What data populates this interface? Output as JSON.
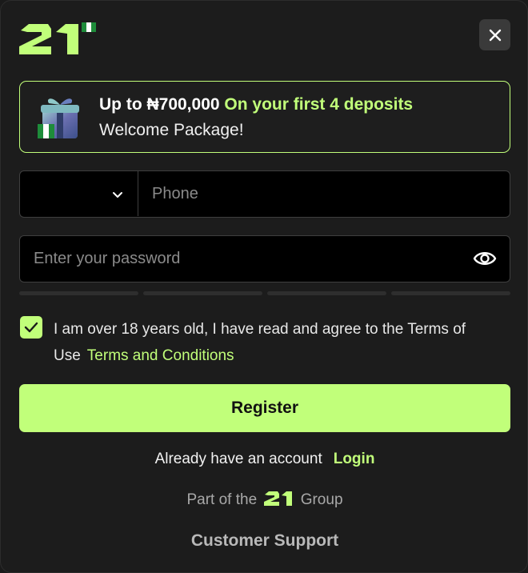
{
  "brand": {
    "logo_text": "21",
    "accent_color": "#c1ff7a",
    "flag": "nigeria-flag"
  },
  "promo": {
    "amount_text": "Up to ₦700,000",
    "highlight_text": "On your first 4 deposits",
    "subtitle": "Welcome Package!",
    "icon": "gift-icon"
  },
  "form": {
    "country_select": {
      "value": "",
      "icon": "chevron-down-icon"
    },
    "phone": {
      "placeholder": "Phone",
      "value": ""
    },
    "password": {
      "placeholder": "Enter your password",
      "value": "",
      "icon": "eye-icon"
    },
    "password_strength_segments": 4,
    "password_strength_level": 0
  },
  "terms": {
    "checked": true,
    "text": "I am over 18 years old, I have read and agree to the Terms of Use",
    "link_text": "Terms and Conditions"
  },
  "actions": {
    "register_label": "Register",
    "login_prompt": "Already have an account",
    "login_label": "Login",
    "close_icon": "close-icon"
  },
  "footer": {
    "group_prefix": "Part of the",
    "group_suffix": "Group",
    "support_label": "Customer Support"
  }
}
